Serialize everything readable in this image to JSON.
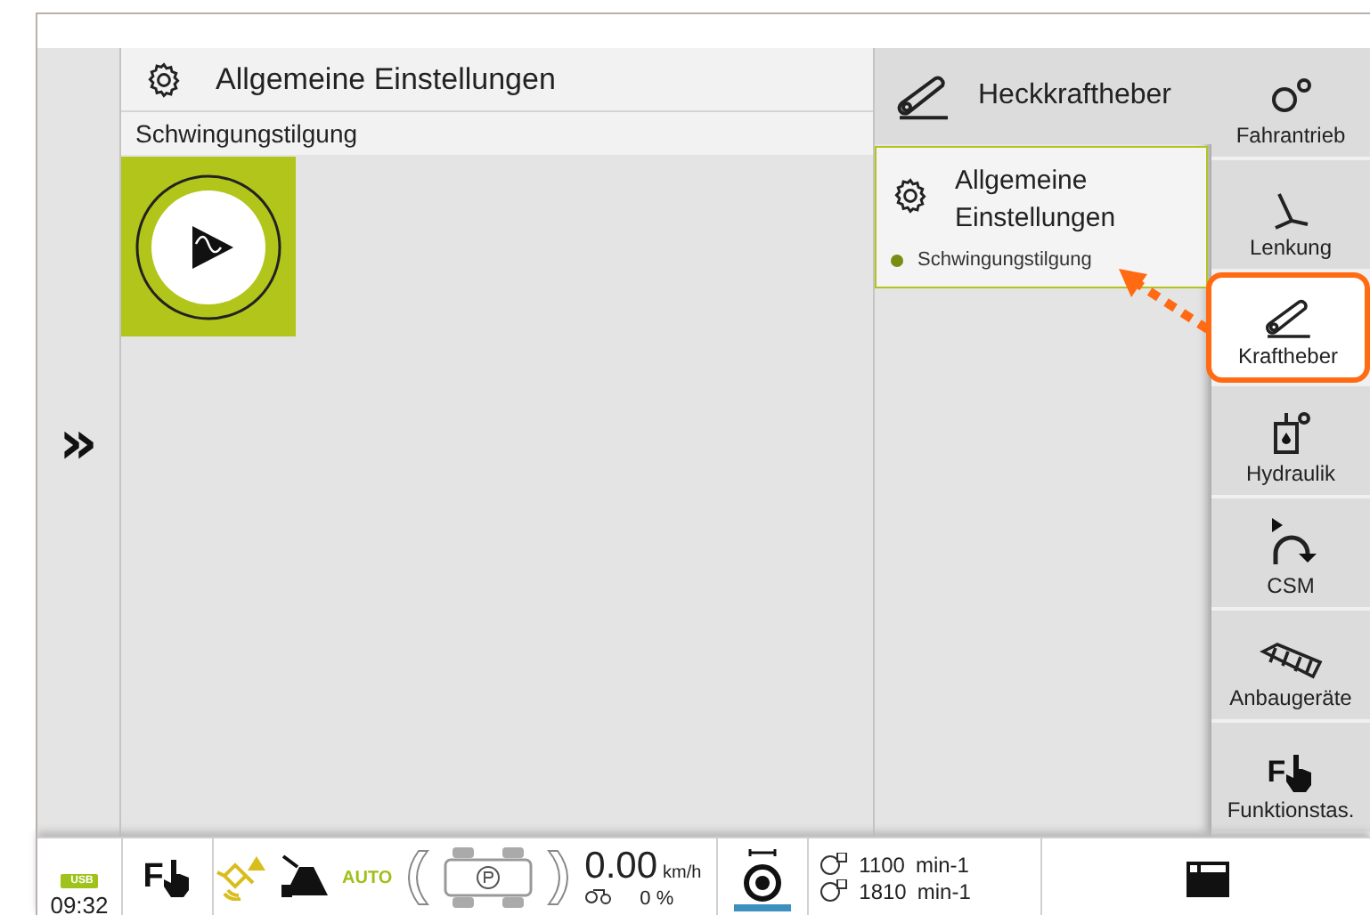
{
  "left_rail": {
    "expand_glyph": "»"
  },
  "main_panel": {
    "title": "Allgemeine Einstellungen",
    "subtitle": "Schwingungstilgung"
  },
  "middle_panel": {
    "title": "Heckkraftheber",
    "cards": [
      {
        "title": "Allgemeine Einstellungen",
        "selected": true,
        "items": [
          {
            "label": "Schwingungstilgung",
            "color": "#7a8c14"
          }
        ]
      }
    ]
  },
  "nav": [
    {
      "label": "Fahrantrieb",
      "kind": "gears",
      "selected": false
    },
    {
      "label": "Lenkung",
      "kind": "steering",
      "selected": false
    },
    {
      "label": "Kraftheber",
      "kind": "hitch",
      "selected": true
    },
    {
      "label": "Hydraulik",
      "kind": "hydraulic",
      "selected": false
    },
    {
      "label": "CSM",
      "kind": "turn",
      "selected": false
    },
    {
      "label": "Anbaugeräte",
      "kind": "implement",
      "selected": false
    },
    {
      "label": "Funktionstas.",
      "kind": "function",
      "glyph": "F",
      "selected": false
    }
  ],
  "status_bar": {
    "usb": "USB",
    "time": "09:32",
    "function_glyph": "F",
    "auto": "AUTO",
    "speed": "0.00",
    "speed_unit": "km/h",
    "slip": "0 %",
    "rpm": [
      {
        "value": "1100",
        "unit": "min-1"
      },
      {
        "value": "1810",
        "unit": "min-1"
      }
    ]
  }
}
